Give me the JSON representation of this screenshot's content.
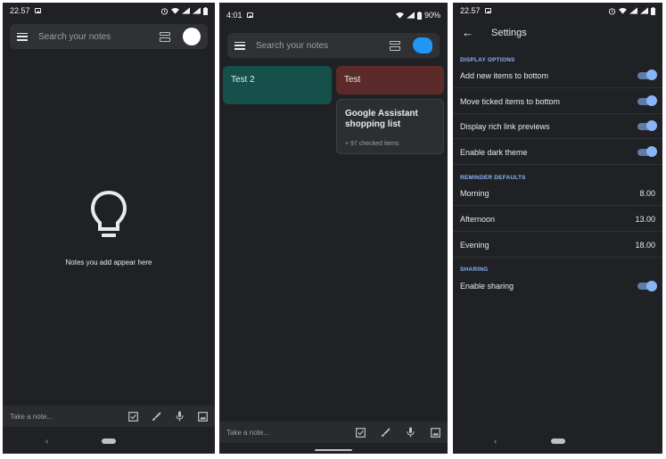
{
  "panel1": {
    "status_time": "22.57",
    "search_placeholder": "Search your notes",
    "empty_text": "Notes you add appear here",
    "take_note_placeholder": "Take a note...",
    "nav_back": "‹"
  },
  "panel2": {
    "status_time": "4:01",
    "battery": "90%",
    "search_placeholder": "Search your notes",
    "notes": [
      {
        "title": "Test 2",
        "color": "#16504b"
      },
      {
        "title": "Test",
        "color": "#5c2b29"
      },
      {
        "title": "Google Assistant shopping list",
        "subtitle": "+ 97 checked items"
      }
    ],
    "take_note_placeholder": "Take a note..."
  },
  "panel3": {
    "status_time": "22.57",
    "title": "Settings",
    "display_options_label": "DISPLAY OPTIONS",
    "display_options": [
      {
        "label": "Add new items to bottom",
        "on": true
      },
      {
        "label": "Move ticked items to bottom",
        "on": true
      },
      {
        "label": "Display rich link previews",
        "on": true
      },
      {
        "label": "Enable dark theme",
        "on": true
      }
    ],
    "reminder_label": "REMINDER DEFAULTS",
    "reminders": [
      {
        "label": "Morning",
        "value": "8.00"
      },
      {
        "label": "Afternoon",
        "value": "13.00"
      },
      {
        "label": "Evening",
        "value": "18.00"
      }
    ],
    "sharing_label": "SHARING",
    "sharing": {
      "label": "Enable sharing",
      "on": true
    },
    "nav_back": "‹"
  },
  "colors": {
    "background": "#202124",
    "accent": "#8ab4f8"
  }
}
